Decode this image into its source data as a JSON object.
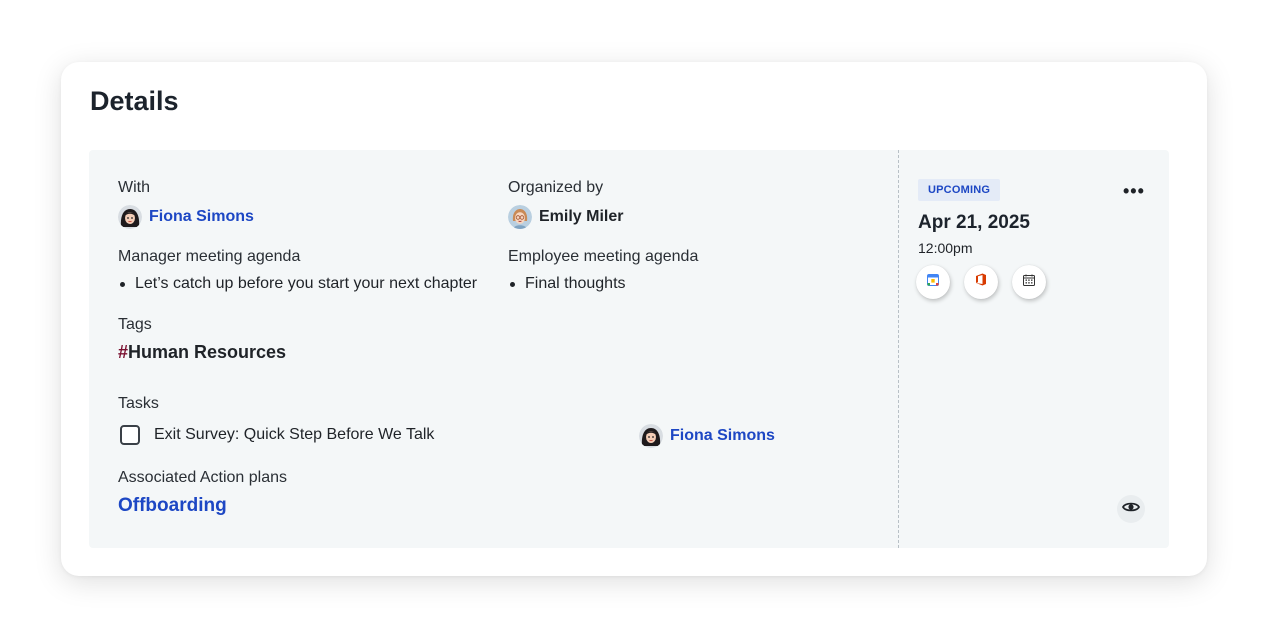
{
  "title": "Details",
  "with": {
    "label": "With",
    "name": "Fiona Simons"
  },
  "organized_by": {
    "label": "Organized by",
    "name": "Emily Miler"
  },
  "manager_agenda": {
    "label": "Manager meeting agenda",
    "items": [
      "Let’s catch up before you start your next chapter"
    ]
  },
  "employee_agenda": {
    "label": "Employee meeting agenda",
    "items": [
      "Final thoughts"
    ]
  },
  "tags": {
    "label": "Tags",
    "items": [
      {
        "hash": "#",
        "name": "Human Resources"
      }
    ]
  },
  "tasks": {
    "label": "Tasks",
    "items": [
      {
        "title": "Exit Survey: Quick Step Before We Talk",
        "assignee": "Fiona Simons",
        "checked": false
      }
    ]
  },
  "action_plans": {
    "label": "Associated Action plans",
    "items": [
      "Offboarding"
    ]
  },
  "meeting": {
    "status": "UPCOMING",
    "date": "Apr 21, 2025",
    "time": "12:00pm",
    "more_label": "•••",
    "calendar_buttons": [
      "google-calendar-icon",
      "office-365-icon",
      "calendar-icon"
    ]
  },
  "colors": {
    "link": "#1d47c4",
    "badge_bg": "#e4ebf7",
    "panel_bg": "#f4f7f8",
    "hash": "#7a1030"
  }
}
